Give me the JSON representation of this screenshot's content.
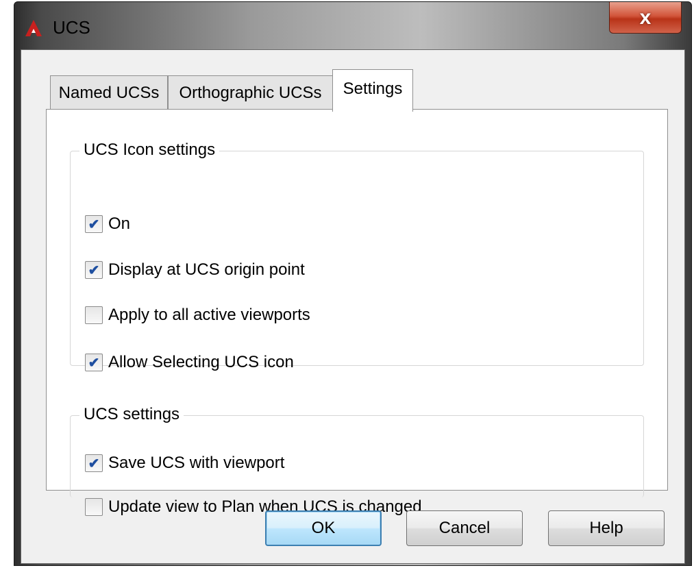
{
  "window": {
    "title": "UCS",
    "close_label": "x"
  },
  "tabs": [
    {
      "label": "Named UCSs",
      "active": false
    },
    {
      "label": "Orthographic UCSs",
      "active": false
    },
    {
      "label": "Settings",
      "active": true
    }
  ],
  "icon_settings": {
    "title": "UCS Icon settings",
    "options": [
      {
        "label": "On",
        "checked": true
      },
      {
        "label": "Display at UCS origin point",
        "checked": true
      },
      {
        "label": "Apply to all active viewports",
        "checked": false
      },
      {
        "label": "Allow Selecting UCS icon",
        "checked": true
      }
    ]
  },
  "ucs_settings": {
    "title": "UCS settings",
    "options": [
      {
        "label": "Save UCS with viewport",
        "checked": true
      },
      {
        "label": "Update view to Plan when UCS is changed",
        "checked": false
      }
    ]
  },
  "buttons": {
    "ok": "OK",
    "cancel": "Cancel",
    "help": "Help"
  },
  "colors": {
    "app_icon": "#c8201e",
    "close_button": "#c7412a",
    "checkmark": "#1f4fa0"
  },
  "check_glyph": "✔"
}
